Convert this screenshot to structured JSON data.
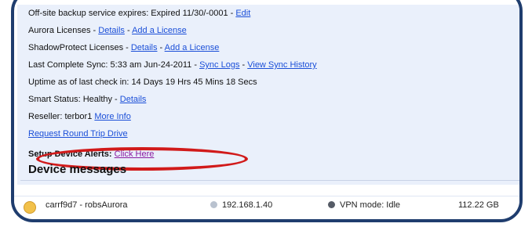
{
  "info": {
    "offsite": {
      "label": "Off-site backup service expires: Expired 11/30/-0001 - ",
      "link": "Edit"
    },
    "aurora": {
      "label": "Aurora Licenses - ",
      "details": "Details",
      "sep": " - ",
      "add": "Add a License"
    },
    "shadowprotect": {
      "label": "ShadowProtect Licenses - ",
      "details": "Details",
      "sep": " - ",
      "add": "Add a License"
    },
    "sync": {
      "label": "Last Complete Sync: 5:33 am Jun-24-2011 - ",
      "sync_logs": "Sync Logs",
      "sep": " - ",
      "history": "View Sync History"
    },
    "uptime": "Uptime as of last check in: 14 Days 19 Hrs 45 Mins 18 Secs",
    "smart": {
      "label": "Smart Status: Healthy - ",
      "link": "Details"
    },
    "reseller": {
      "label": "Reseller: terbor1 ",
      "link": "More Info"
    },
    "round_trip": "Request Round Trip Drive",
    "alerts": {
      "label": "Setup Device Alerts: ",
      "link": "Click Here"
    }
  },
  "section_title": "Device messages",
  "device": {
    "name": "carrf9d7 - robsAurora",
    "ip": "192.168.1.40",
    "vpn": "VPN mode: Idle",
    "size": "112.22 GB"
  },
  "colors": {
    "link": "#1b4fd8",
    "visited": "#8a1aa0",
    "highlight": "#d11a1a",
    "frame": "#1f3d6e"
  }
}
